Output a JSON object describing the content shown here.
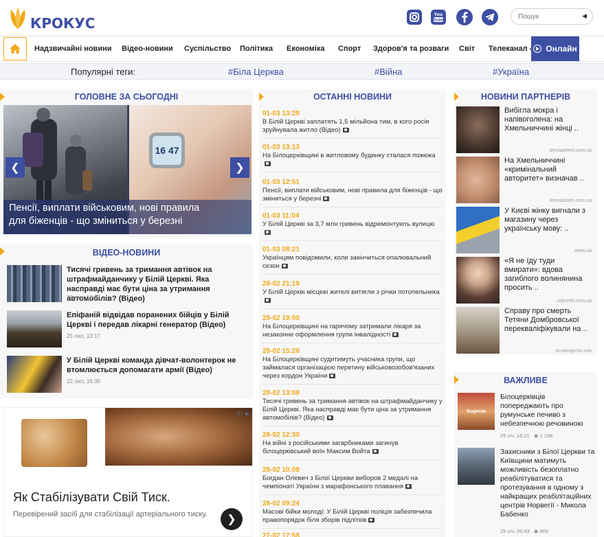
{
  "brand": {
    "name": "КРОКУС",
    "accent": "#f1a91b",
    "primary": "#3d4fa3"
  },
  "header": {
    "socials": [
      "instagram-icon",
      "youtube-icon",
      "facebook-icon",
      "telegram-icon"
    ],
    "search_placeholder": "Пошук"
  },
  "nav": {
    "items": [
      "Надзвичайні новини",
      "Відео-новини",
      "Суспільство",
      "Політика",
      "Економіка",
      "Спорт",
      "Здоров'я та розваги",
      "Світ",
      "Телеканал"
    ],
    "online": "Онлайн"
  },
  "tags": {
    "label": "Популярні теги:",
    "items": [
      "#Біла Церква",
      "#Війна",
      "#Україна"
    ]
  },
  "main_today": {
    "title": "ГОЛОВНЕ ЗА СЬОГОДНІ",
    "slide_caption": "Пенсії, виплати військовим, нові правила для біженців - що зміниться у березні",
    "watch_text": "16 47"
  },
  "video_news": {
    "title": "ВІДЕО-НОВИНИ",
    "items": [
      {
        "title": "Тисячі гривень за тримання автівок на штрафмайданчику у Білій Церкві. Яка насправді має бути ціна за утримання автомобілів? (Відео)",
        "date": "28 лют, 13:08"
      },
      {
        "title": "Епіфаній відвідав поранених бійців у Білій Церкві і передав лікарні генератор (Відео)",
        "date": "25 лют, 13:17"
      },
      {
        "title": "У Білій Церкві команда дівчат-волонтерок не втомлюється допомагати армії (Відео)",
        "date": "22 лют, 16:30"
      }
    ]
  },
  "ad": {
    "title": "Як Стабілізувати Свій Тиск.",
    "desc": "Перевірений засіб для стабілізації артеріального тиску."
  },
  "latest_news": {
    "title": "ОСТАННІ НОВИНИ",
    "items": [
      {
        "time": "01-03 13:28",
        "text": "В Білій Церкві заплатять 1,5 мільйона тим, в кого росія зруйнувала житло (Відео)",
        "cam": true
      },
      {
        "time": "01-03 13:13",
        "text": "На Білоцерківщині в житловому будинку сталася пожежа",
        "cam": true
      },
      {
        "time": "01-03 12:51",
        "text": "Пенсії, виплати військовим, нові правила для біженців - що зміниться у березні",
        "cam": true
      },
      {
        "time": "01-03 11:04",
        "text": "У Білій Церкві за 3,7 млн гривень відремонтують вулицю",
        "cam": true
      },
      {
        "time": "01-03 08:21",
        "text": "Українцям повідомили, коли закінчиться опалювальний сезон",
        "cam": true
      },
      {
        "time": "28-02 21:19",
        "text": "У Білій Церкві місцеві жителі витягли з річки потопельника",
        "cam": true
      },
      {
        "time": "28-02 19:00",
        "text": "На Білоцерківщині на гарячому затримали лікаря за незаконне оформлення групи інвалідності",
        "cam": true
      },
      {
        "time": "28-02 15:28",
        "text": "На Білоцерківщині судитимуть учасника групи, що займалася організацією перетину військовозобов'язаних через кордон України",
        "cam": true
      },
      {
        "time": "28-02 13:08",
        "text": "Тисячі гривень за тримання автівок на штрафмайданчику у Білій Церкві. Яка насправді має бути ціна за утримання автомобілів? (Відео)",
        "cam": true
      },
      {
        "time": "28-02 12:30",
        "text": "На війні з російськими загарбниками загинув білоцерківський воїн Максим Войта",
        "cam": true
      },
      {
        "time": "28-02 10:08",
        "text": "Богдан Олевич з Білої Церкви виборов 2 медалі на чемпіонаті України з марафонського плавання",
        "cam": true
      },
      {
        "time": "28-02 09:24",
        "text": "Масові бійки молоді: У Білій Церкві поліція забезпечила правопорядок біля зборів підлітків",
        "cam": true
      },
      {
        "time": "27-02 17:58",
        "text": "",
        "cam": false
      }
    ]
  },
  "partners": {
    "title": "НОВИНИ ПАРТНЕРІВ",
    "items": [
      {
        "title": "Вибігла мокра і напівоголена: на Хмельниччині жінці ..",
        "source": "densadnem.com.ua"
      },
      {
        "title": "На Хмельниччині «кримінальний авторитет» визначав ..",
        "source": "densadnem.com.ua"
      },
      {
        "title": "У Києві жінку вигнали з магазину через українську мову: ..",
        "source": "meta.ua"
      },
      {
        "title": "«Я не їду туди вмирати»: вдова загиблого волинянина просить ..",
        "source": "volynnfo.com.ua"
      },
      {
        "title": "Справу про смерть Тетяни Домбровської перекваліфікували на ..",
        "source": "no-berdychiv.info"
      }
    ]
  },
  "important": {
    "title": "ВАЖЛИВЕ",
    "items": [
      {
        "title": "Білоцерківців попереджають про румунське печиво з небезпечною речовиною",
        "date": "25 січ, 16:21",
        "views": "1 198",
        "thumb_text": "Eugenia"
      },
      {
        "title": "Захисники з Білої Церкви та Київщини матимуть можливість безоплатно реабілітуватися та протезування в одному з найкращих реабілітаційних центрів Норвегії - Микола Бабенко",
        "date": "25 січ, 09:43",
        "views": "909"
      }
    ]
  }
}
